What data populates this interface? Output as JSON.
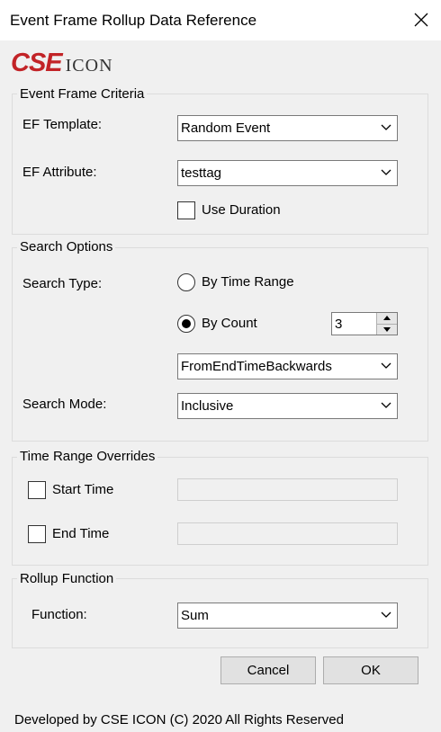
{
  "window": {
    "title": "Event Frame Rollup Data Reference"
  },
  "logo": {
    "brand": "CSE",
    "product": "ICON",
    "brand_color": "#c22327"
  },
  "ef_criteria": {
    "legend": "Event Frame Criteria",
    "template_label": "EF Template:",
    "template_value": "Random Event",
    "attribute_label": "EF Attribute:",
    "attribute_value": "testtag",
    "use_duration_label": "Use Duration",
    "use_duration_checked": false
  },
  "search_options": {
    "legend": "Search Options",
    "type_label": "Search Type:",
    "by_time_range_label": "By Time Range",
    "by_count_label": "By Count",
    "selected": "By Count",
    "count_value": "3",
    "direction_value": "FromEndTimeBackwards",
    "mode_label": "Search Mode:",
    "mode_value": "Inclusive"
  },
  "time_overrides": {
    "legend": "Time Range Overrides",
    "start_label": "Start Time",
    "end_label": "End Time",
    "start_value": "",
    "end_value": ""
  },
  "rollup": {
    "legend": "Rollup Function",
    "function_label": "Function:",
    "function_value": "Sum"
  },
  "buttons": {
    "cancel": "Cancel",
    "ok": "OK"
  },
  "footer": {
    "text": "Developed by CSE ICON (C) 2020 All Rights Reserved"
  },
  "icons": {
    "close": "close-icon",
    "dropdown": "chevron-down-icon",
    "spin_up": "spin-up-icon",
    "spin_down": "spin-down-icon"
  }
}
